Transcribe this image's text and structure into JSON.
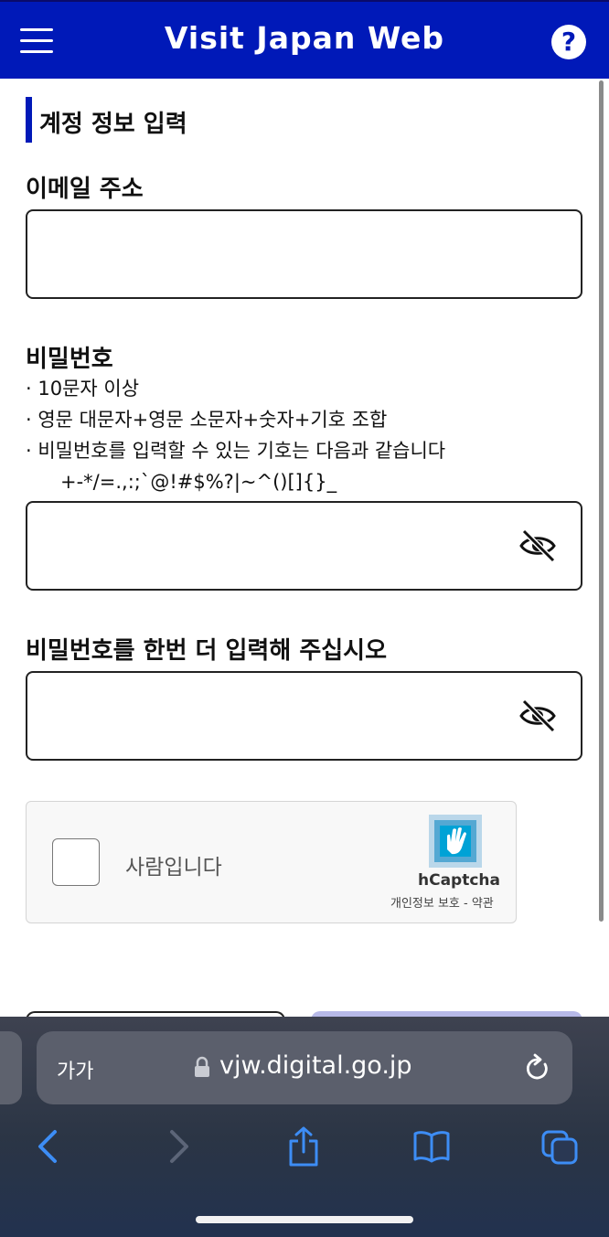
{
  "header": {
    "title": "Visit Japan Web",
    "help_label": "?"
  },
  "section": {
    "title": "계정 정보 입력"
  },
  "email": {
    "label": "이메일 주소",
    "value": "",
    "placeholder": ""
  },
  "password": {
    "label": "비밀번호",
    "rules": [
      "· 10문자 이상",
      "· 영문 대문자+영문 소문자+숫자+기호 조합",
      "· 비밀번호를 입력할 수 있는 기호는 다음과 같습니다"
    ],
    "symbols": "+-*/=.,:;`@!#$%?|~^()[]{}_",
    "value": "",
    "visibility_icon": "eye-slash-icon"
  },
  "password_confirm": {
    "label": "비밀번호를 한번 더 입력해 주십시오",
    "value": "",
    "visibility_icon": "eye-slash-icon"
  },
  "captcha": {
    "checkbox_label": "사람입니다",
    "brand": "hCaptcha",
    "links": "개인정보 보호 - 약관"
  },
  "browser": {
    "text_size_label": "가가",
    "url": "vjw.digital.go.jp"
  },
  "colors": {
    "brand_blue": "#0019b8",
    "next_button_disabled": "#b7b9e8",
    "ios_blue": "#3d8df5"
  }
}
